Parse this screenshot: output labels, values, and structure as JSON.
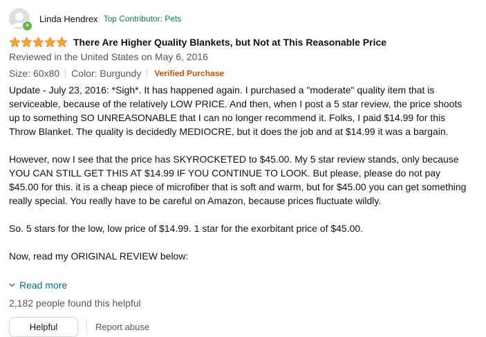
{
  "reviewer": {
    "name": "Linda Hendrex",
    "badge": "Top Contributor: Pets",
    "badge_icon": "+"
  },
  "rating": {
    "stars": 5,
    "max": 5,
    "star_color": "#ffa41c"
  },
  "review": {
    "title": "There Are Higher Quality Blankets, but Not at This Reasonable Price",
    "date": "Reviewed in the United States on May 6, 2016",
    "size": "Size: 60x80",
    "color": "Color: Burgundy",
    "verified": "Verified Purchase",
    "paragraphs": [
      "Update - July 23, 2016: *Sigh*. It has happened again. I purchased a \"moderate\" quality item that is serviceable, because of the relatively LOW PRICE. And then, when I post a 5 star review, the price shoots up to something SO UNREASONABLE that I can no longer recommend it. Folks, I paid $14.99 for this Throw Blanket. The quality is decidedly MEDIOCRE, but it does the job and at $14.99 it was a bargain.",
      "However, now I see that the price has SKYROCKETED to $45.00. My 5 star review stands, only because YOU CAN STILL GET THIS AT $14.99 IF YOU CONTINUE TO LOOK. But please, please do not pay $45.00 for this. it is a cheap piece of microfiber that is soft and warm, but for $45.00 you can get something really special. You really have to be careful on Amazon, because prices fluctuate wildly.",
      "So. 5 stars for the low, low price of $14.99. 1 star for the exorbitant price of $45.00.",
      "Now, read my ORIGINAL REVIEW below:"
    ]
  },
  "read_more": "Read more",
  "helpful_count": "2,182 people found this helpful",
  "actions": {
    "helpful": "Helpful",
    "report": "Report abuse"
  },
  "colors": {
    "link": "#007185",
    "verified": "#c45500",
    "contributor": "#067d62"
  }
}
